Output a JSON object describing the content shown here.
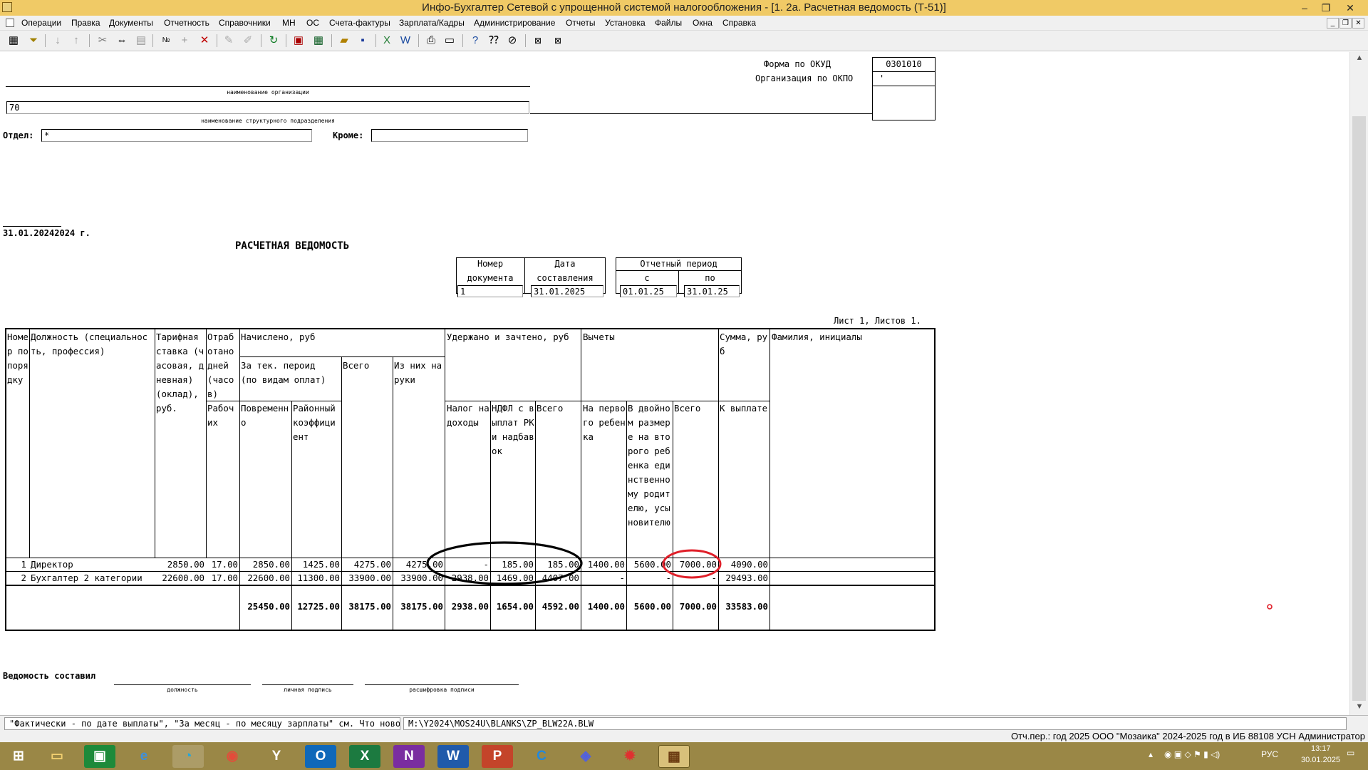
{
  "window": {
    "title": "Инфо-Бухгалтер Сетевой с упрощенной системой налогообложения - [1. 2а. Расчетная ведомость (Т-51)]"
  },
  "menu": [
    "Операции",
    "Правка",
    "Документы",
    "Отчетность",
    "Справочники",
    "МН",
    "ОС",
    "Счета-фактуры",
    "Зарплата/Кадры",
    "Администрирование",
    "Отчеты",
    "Установка",
    "Файлы",
    "Окна",
    "Справка"
  ],
  "form": {
    "okud_label": "Форма по ОКУД",
    "okud_value": "0301010",
    "okpo_label": "Организация по ОКПО",
    "okpo_value": "'",
    "org_caption": "наименование организации",
    "subdivision_value": "70",
    "subdivision_caption": "наименование структурного подразделения",
    "dept_label": "Отдел:",
    "dept_value": "*",
    "except_label": "Кроме:",
    "except_value": "",
    "date_text": "31.01.20242024 г.",
    "doc_title": "РАСЧЕТНАЯ ВЕДОМОСТЬ",
    "docnum_header_1": "Номер",
    "docnum_header_2": "документа",
    "docnum_value": "1",
    "docdate_header_1": "Дата",
    "docdate_header_2": "составления",
    "docdate_value": "31.01.2025",
    "period_header": "Отчетный период",
    "period_from_label": "с",
    "period_to_label": "по",
    "period_from": "01.01.25",
    "period_to": "31.01.25",
    "sheet_text": "Лист 1, Листов 1."
  },
  "table": {
    "h_num": "Номер по порядку",
    "h_position": "Должность (специальность, профессия)",
    "h_rate": "Тарифная ставка (часовая, дневная) (оклад), руб.",
    "h_worked": "Отработано дней (часов)",
    "h_working": "Рабочих",
    "h_accrued": "Начислено, руб",
    "h_current": "За тек. пероид",
    "h_bytype": "(по видам оплат)",
    "h_time": "Повременно",
    "h_district": "Районный коэффициент",
    "h_total": "Всего",
    "h_handed": "Из них на руки",
    "h_withheld": "Удержано и зачтено, руб",
    "h_tax": "Налог на доходы",
    "h_ndfl": "НДФЛ с выплат РК и надбавок",
    "h_withheld_total": "Всего",
    "h_deductions": "Вычеты",
    "h_first_child": "На первого ребенка",
    "h_double": "В двойном размере на второго ребенка единственному родителю, усыновителю",
    "h_ded_total": "Всего",
    "h_sum": "Сумма, руб",
    "h_topay": "К выплате",
    "h_name": "Фамилия, инициалы",
    "rows": [
      {
        "n": "1",
        "position": "Директор",
        "rate": "2850.00",
        "days": "17.00",
        "time": "2850.00",
        "district": "1425.00",
        "total": "4275.00",
        "handed": "4275.00",
        "tax": "-",
        "ndfl": "185.00",
        "wtotal": "185.00",
        "first": "1400.00",
        "double": "5600.00",
        "dtotal": "7000.00",
        "topay": "4090.00",
        "name": ""
      },
      {
        "n": "2",
        "position": "Бухгалтер 2 категории",
        "rate": "22600.00",
        "days": "17.00",
        "time": "22600.00",
        "district": "11300.00",
        "total": "33900.00",
        "handed": "33900.00",
        "tax": "2938.00",
        "ndfl": "1469.00",
        "wtotal": "4407.00",
        "first": "-",
        "double": "-",
        "dtotal": "-",
        "topay": "29493.00",
        "name": ""
      }
    ],
    "totals": {
      "time": "25450.00",
      "district": "12725.00",
      "total": "38175.00",
      "handed": "38175.00",
      "tax": "2938.00",
      "ndfl": "1654.00",
      "wtotal": "4592.00",
      "first": "1400.00",
      "double": "5600.00",
      "dtotal": "7000.00",
      "topay": "33583.00"
    }
  },
  "footer": {
    "compiled_label": "Ведомость составил",
    "cap_position": "должность",
    "cap_signature": "личная подпись",
    "cap_decoding": "расшифровка подписи"
  },
  "status": {
    "hint": "\"Фактически - по дате выплаты\", \"За месяц - по месяцу зарплаты\" см. Что нового",
    "path": "M:\\Y2024\\MOS24U\\BLANKS\\ZP_BLW22A.BLW",
    "info": "Отч.пер.: год 2025  ООО \"Мозаика\" 2024-2025 год в ИБ 88108 УСН  Администратор"
  },
  "taskbar": {
    "lang": "РУС",
    "time": "13:17",
    "date": "30.01.2025"
  },
  "colors": {
    "titlebar": "#f0ca66",
    "taskbar": "#9a8746",
    "annotation_black": "#000000",
    "annotation_red": "#e0202a"
  }
}
